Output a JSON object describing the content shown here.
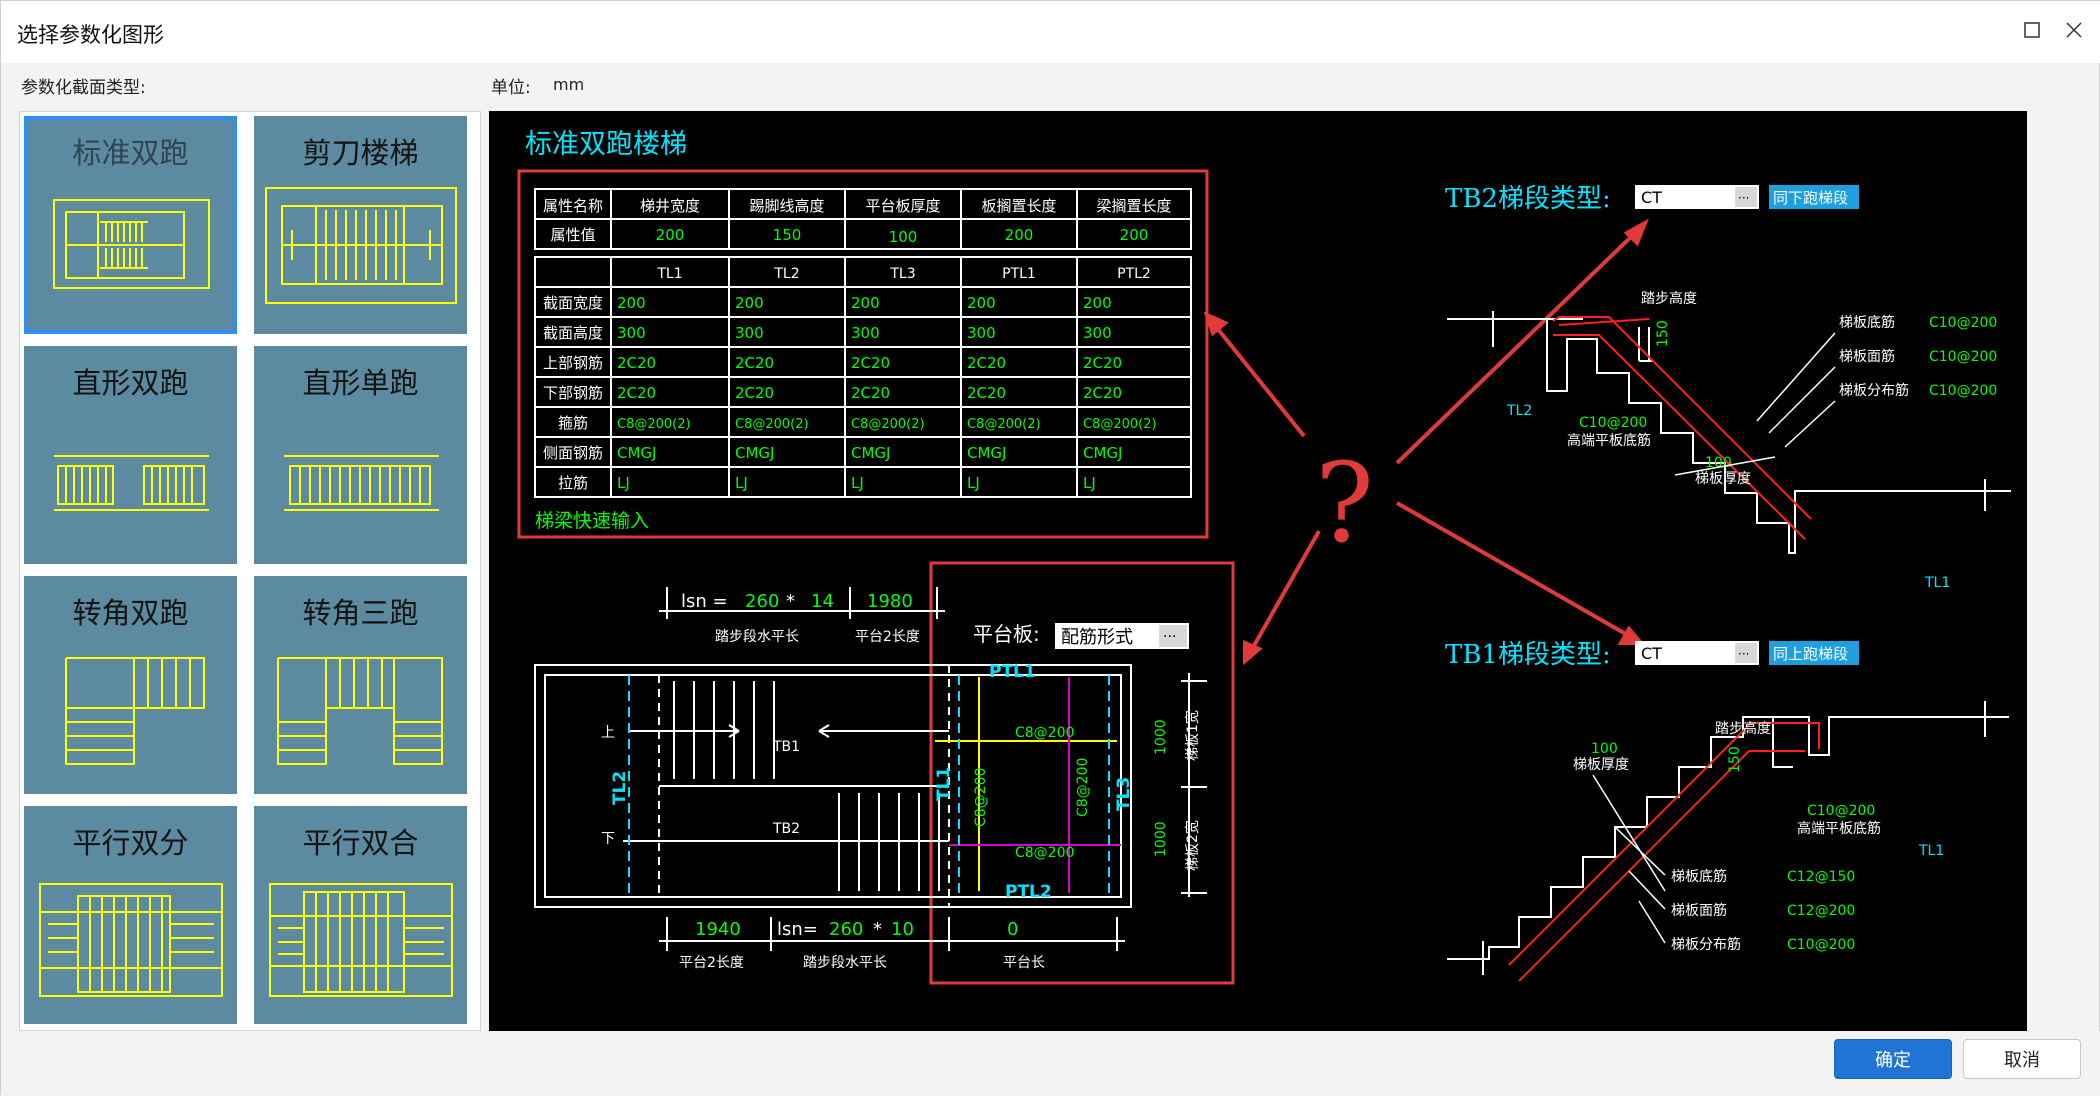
{
  "window": {
    "title": "选择参数化图形"
  },
  "labels": {
    "section_type": "参数化截面类型:",
    "unit_label": "单位:",
    "unit_value": "mm"
  },
  "cards": [
    {
      "label": "标准双跑",
      "icon": "standard-double-run-icon",
      "selected": true
    },
    {
      "label": "剪刀楼梯",
      "icon": "scissor-stair-icon",
      "selected": false
    },
    {
      "label": "直形双跑",
      "icon": "straight-double-run-icon",
      "selected": false
    },
    {
      "label": "直形单跑",
      "icon": "straight-single-run-icon",
      "selected": false
    },
    {
      "label": "转角双跑",
      "icon": "corner-double-run-icon",
      "selected": false
    },
    {
      "label": "转角三跑",
      "icon": "corner-triple-run-icon",
      "selected": false
    },
    {
      "label": "平行双分",
      "icon": "parallel-split-icon",
      "selected": false
    },
    {
      "label": "平行双合",
      "icon": "parallel-merge-icon",
      "selected": false
    }
  ],
  "preview": {
    "title": "标准双跑楼梯",
    "prop_headers": [
      "属性名称",
      "梯井宽度",
      "踢脚线高度",
      "平台板厚度",
      "板搁置长度",
      "梁搁置长度"
    ],
    "prop_values": [
      "属性值",
      "200",
      "150",
      "100",
      "200",
      "200"
    ],
    "beam_headers": [
      "TL1",
      "TL2",
      "TL3",
      "PTL1",
      "PTL2"
    ],
    "beam_rows": [
      {
        "label": "截面宽度",
        "values": [
          "200",
          "200",
          "200",
          "200",
          "200"
        ]
      },
      {
        "label": "截面高度",
        "values": [
          "300",
          "300",
          "300",
          "300",
          "300"
        ]
      },
      {
        "label": "上部钢筋",
        "values": [
          "2C20",
          "2C20",
          "2C20",
          "2C20",
          "2C20"
        ]
      },
      {
        "label": "下部钢筋",
        "values": [
          "2C20",
          "2C20",
          "2C20",
          "2C20",
          "2C20"
        ]
      },
      {
        "label": "箍筋",
        "values": [
          "C8@200(2)",
          "C8@200(2)",
          "C8@200(2)",
          "C8@200(2)",
          "C8@200(2)"
        ]
      },
      {
        "label": "侧面钢筋",
        "values": [
          "CMGJ",
          "CMGJ",
          "CMGJ",
          "CMGJ",
          "CMGJ"
        ]
      },
      {
        "label": "拉筋",
        "values": [
          "LJ",
          "LJ",
          "LJ",
          "LJ",
          "LJ"
        ]
      }
    ],
    "quick_input": "梯梁快速输入",
    "plan": {
      "lsn1_prefix": "lsn =",
      "lsn1_a": "260",
      "lsn1_op": "*",
      "lsn1_b": "14",
      "top_plat": "1980",
      "tread_len": "踏步段水平长",
      "plat2_len": "平台2长度",
      "plat_label": "平台板:",
      "plat_select": "配筋形式",
      "up": "上",
      "down": "下",
      "tb1": "TB1",
      "tb2": "TB2",
      "tl1": "TL1",
      "tl2": "TL2",
      "tl3": "TL3",
      "ptl1": "PTL1",
      "ptl2": "PTL2",
      "c8_a": "C8@200",
      "c8_b": "C8@200",
      "c8_c": "C8@200",
      "c8_d": "C8@200",
      "w1": "1000",
      "w2": "1000",
      "w1_lbl": "梯板1宽",
      "w2_lbl": "梯板2宽",
      "bot_plat": "1940",
      "lsn2_prefix": "lsn=",
      "lsn2_a": "260",
      "lsn2_op": "*",
      "lsn2_b": "10",
      "plat_len_val": "0",
      "bot_plat2_len": "平台2长度",
      "bot_tread_len": "踏步段水平长",
      "plat_len": "平台长"
    },
    "tb2": {
      "label": "TB2梯段类型:",
      "value": "CT",
      "button": "同下跑梯段",
      "step_h": "踏步高度",
      "step_val": "150",
      "tl2": "TL2",
      "bot_rebar_lbl": "梯板底筋",
      "bot_rebar": "C10@200",
      "top_rebar_lbl": "梯板面筋",
      "top_rebar": "C10@200",
      "dist_rebar_lbl": "梯板分布筋",
      "dist_rebar": "C10@200",
      "end_rebar": "C10@200",
      "end_rebar_lbl": "高端平板底筋",
      "thick": "100",
      "thick_lbl": "梯板厚度",
      "tl1": "TL1"
    },
    "tb1": {
      "label": "TB1梯段类型:",
      "value": "CT",
      "button": "同上跑梯段",
      "step_h": "踏步高度",
      "step_val": "150",
      "thick": "100",
      "thick_lbl": "梯板厚度",
      "tl1": "TL1",
      "end_rebar": "C10@200",
      "end_rebar_lbl": "高端平板底筋",
      "bot_rebar_lbl": "梯板底筋",
      "bot_rebar": "C12@150",
      "top_rebar_lbl": "梯板面筋",
      "top_rebar": "C12@200",
      "dist_rebar_lbl": "梯板分布筋",
      "dist_rebar": "C10@200"
    },
    "question_mark": "?"
  },
  "buttons": {
    "ok": "确定",
    "cancel": "取消"
  },
  "colors": {
    "accent": "#1f74d6",
    "card": "#5c8aa0",
    "cyan": "#00e5ff",
    "green": "#00ff00",
    "yellow": "#ffff00",
    "red_mark": "#e03a3a"
  }
}
